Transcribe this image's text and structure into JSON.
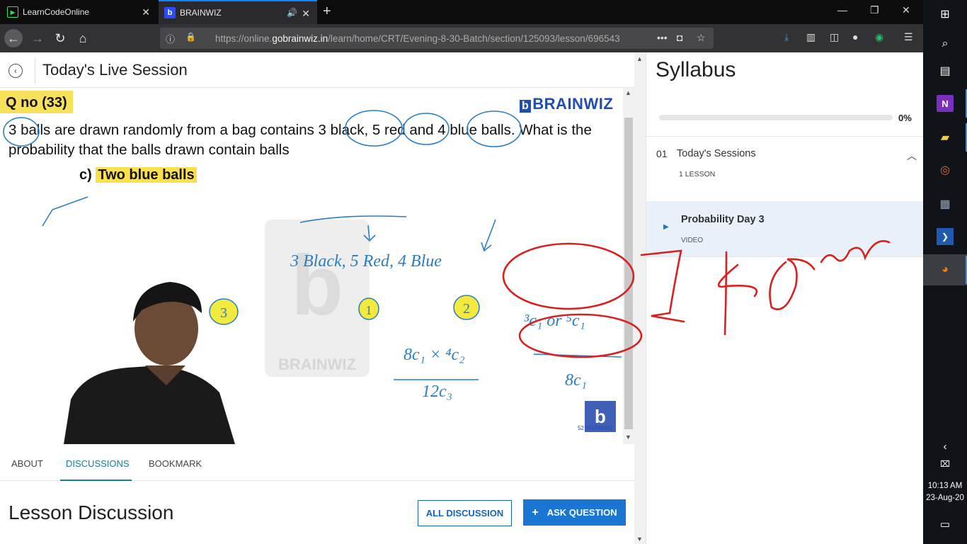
{
  "browser": {
    "tabs": [
      {
        "title": "LearnCodeOnline",
        "active": false
      },
      {
        "title": "BRAINWIZ",
        "active": true
      }
    ],
    "url_prefix": "https://online.",
    "url_host": "gobrainwiz.in",
    "url_path": "/learn/home/CRT/Evening-8-30-Batch/section/125093/lesson/696543",
    "page_actions_label": "•••",
    "favicon_2_letter": "b"
  },
  "header": {
    "title": "Today's Live Session"
  },
  "video": {
    "qno": "Q no (33)",
    "brand": "BRAINWIZ",
    "brand_mark": "b",
    "question": "3 balls are drawn randomly from a bag contains 3 black, 5 red and 4 blue balls. What is the probability that the balls drawn contain balls",
    "option_prefix": "c)",
    "option_text": "Two blue balls",
    "watermark": "BRAINWIZ",
    "small_logo_letter": "b",
    "small_logo_caption": "52",
    "small_logo_caption2": "BRAINWIZ"
  },
  "tabs": {
    "about": "ABOUT",
    "discussions": "DISCUSSIONS",
    "bookmark": "BOOKMARK",
    "active": "DISCUSSIONS"
  },
  "discussion": {
    "title": "Lesson Discussion",
    "all_button": "ALL DISCUSSION",
    "ask_button": "ASK QUESTION"
  },
  "syllabus": {
    "title": "Syllabus",
    "progress_pct": "0%",
    "progress_value": 0,
    "section_number": "01",
    "section_name": "Today's Sessions",
    "section_meta": "1 LESSON",
    "lesson_name": "Probability Day 3",
    "lesson_type": "VIDEO"
  },
  "taskbar": {
    "time": "10:13 AM",
    "date": "23-Aug-20"
  },
  "colors": {
    "accent": "#1976d2",
    "teal": "#1a7d8d",
    "highlight": "#f7e05a",
    "ink_blue": "#2a7fc4",
    "ink_red": "#d8201e"
  }
}
